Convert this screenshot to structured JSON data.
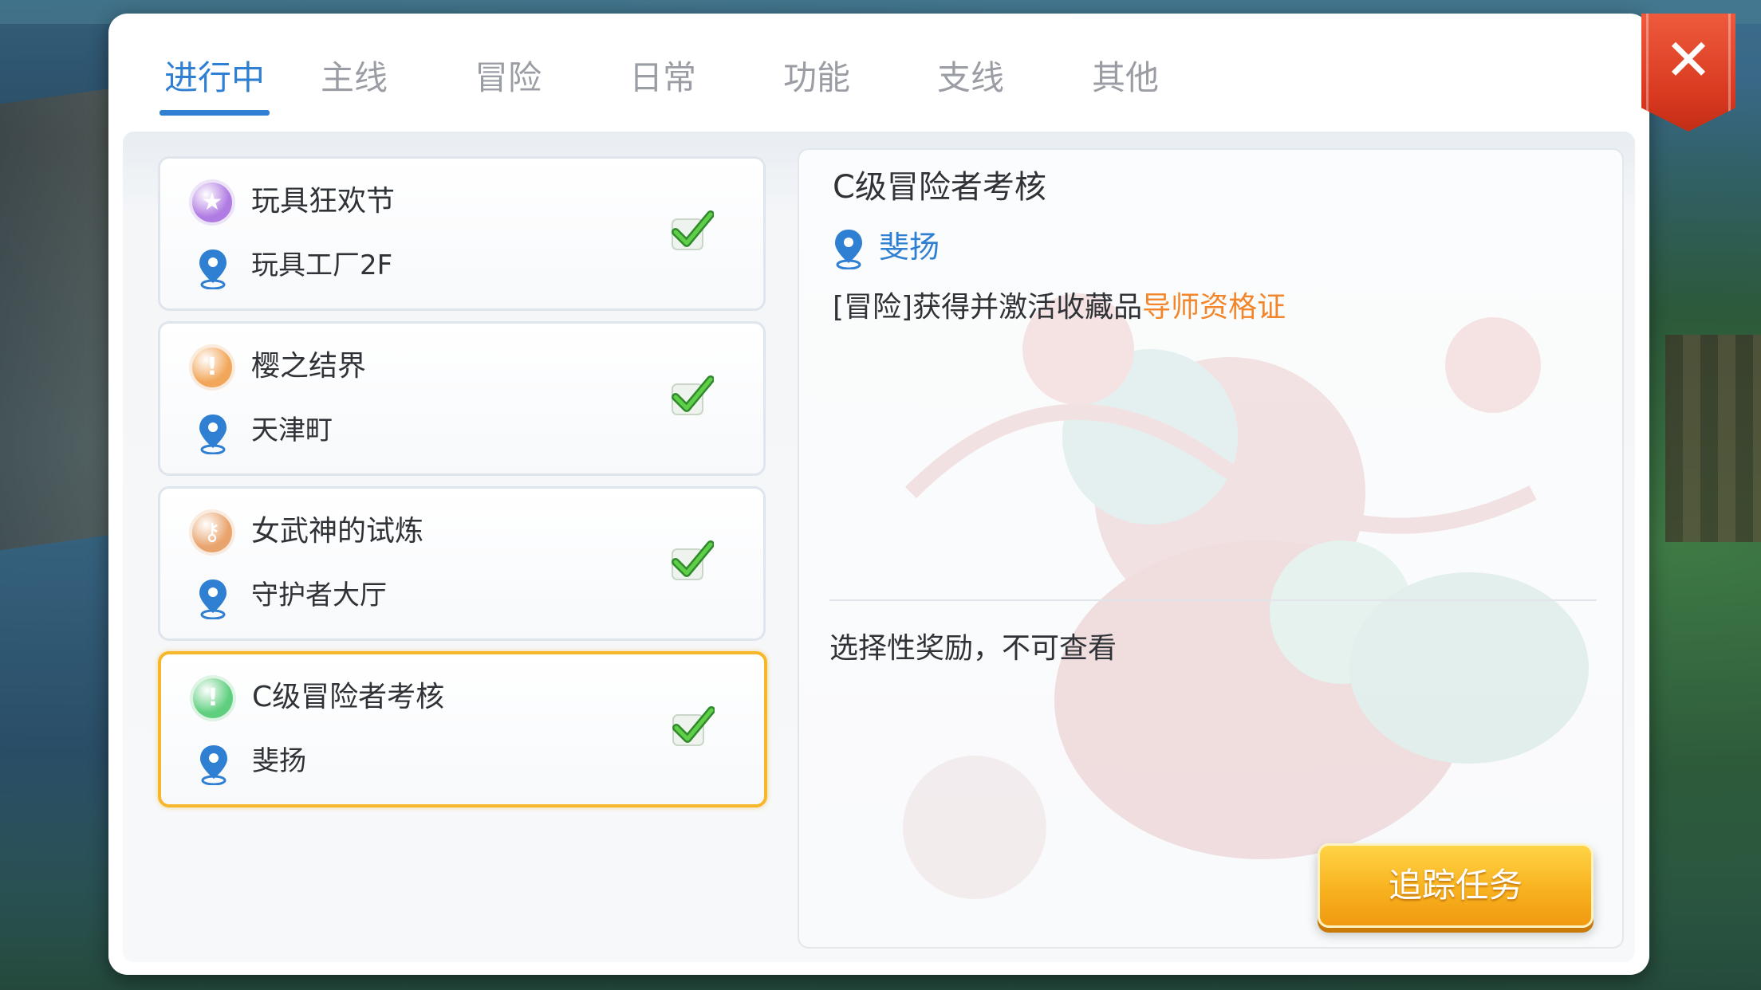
{
  "tabs": [
    {
      "label": "进行中",
      "active": true
    },
    {
      "label": "主线"
    },
    {
      "label": "冒险"
    },
    {
      "label": "日常"
    },
    {
      "label": "功能"
    },
    {
      "label": "支线"
    },
    {
      "label": "其他"
    }
  ],
  "close_symbol": "✕",
  "quests": [
    {
      "name": "玩具狂欢节",
      "location": "玩具工厂2F",
      "icon": "star-icon",
      "icon_color": "#b07be3",
      "completed": true
    },
    {
      "name": "樱之结界",
      "location": "天津町",
      "icon": "exclamation-icon",
      "icon_color": "#f2a65a",
      "completed": true
    },
    {
      "name": "女武神的试炼",
      "location": "守护者大厅",
      "icon": "key-icon",
      "icon_color": "#e9a36c",
      "completed": true
    },
    {
      "name": "C级冒险者考核",
      "location": "斐扬",
      "icon": "exclamation-icon",
      "icon_color": "#5fcf7f",
      "completed": true,
      "selected": true
    }
  ],
  "detail": {
    "title": "C级冒险者考核",
    "location": "斐扬",
    "desc_prefix": "[冒险]获得并激活收藏品",
    "desc_highlight": "导师资格证",
    "reward_note": "选择性奖励，不可查看"
  },
  "track_button": "追踪任务",
  "colors": {
    "accent_blue": "#2f7fd3",
    "highlight_orange": "#f3862a",
    "selected_border": "#f6b82a",
    "check_green": "#3fa83a"
  }
}
